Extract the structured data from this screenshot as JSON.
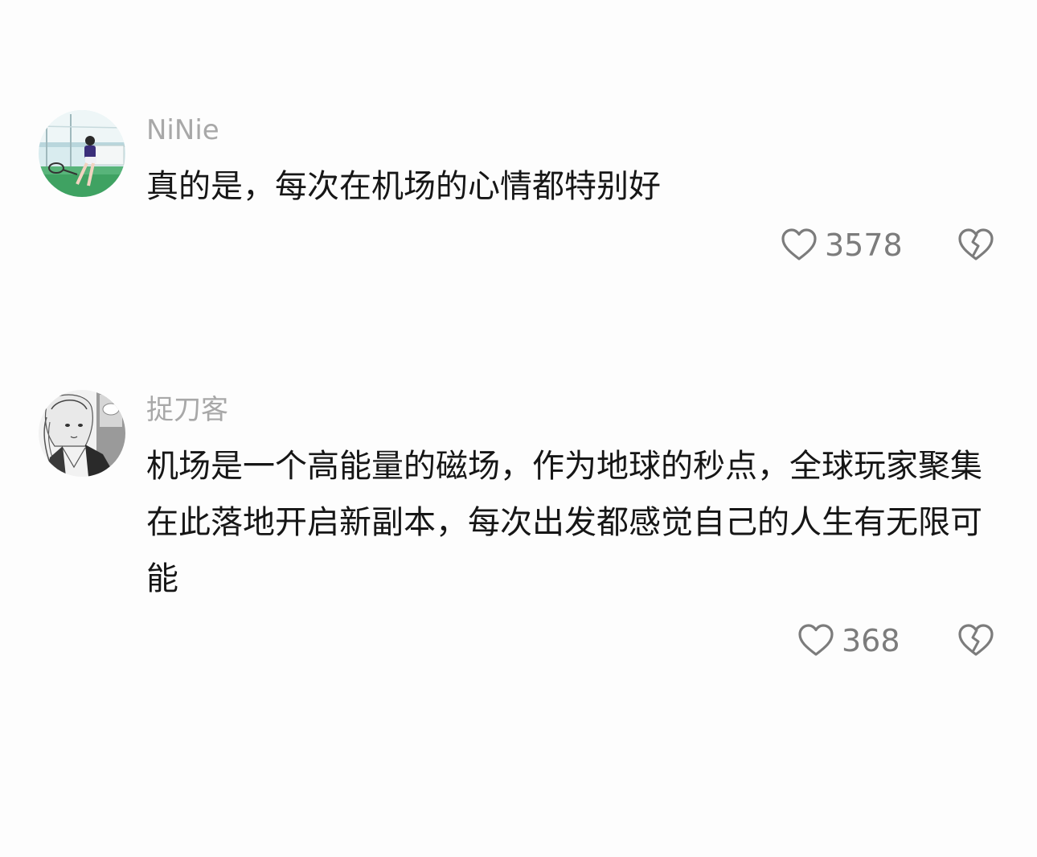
{
  "comments": [
    {
      "username": "NiNie",
      "text": "真的是，每次在机场的心情都特别好",
      "likes": "3578",
      "avatar_icon": "avatar-tennis-player"
    },
    {
      "username": "捉刀客",
      "text": "机场是一个高能量的磁场，作为地球的秒点，全球玩家聚集在此落地开启新副本，每次出发都感觉自己的人生有无限可能",
      "likes": "368",
      "avatar_icon": "avatar-manga-girl"
    }
  ],
  "icons": {
    "like": "heart-outline-icon",
    "dislike": "broken-heart-icon"
  },
  "colors": {
    "background": "#fdfdfd",
    "username": "#a8a8a8",
    "body_text": "#161616",
    "icon": "#7c7c7c"
  }
}
